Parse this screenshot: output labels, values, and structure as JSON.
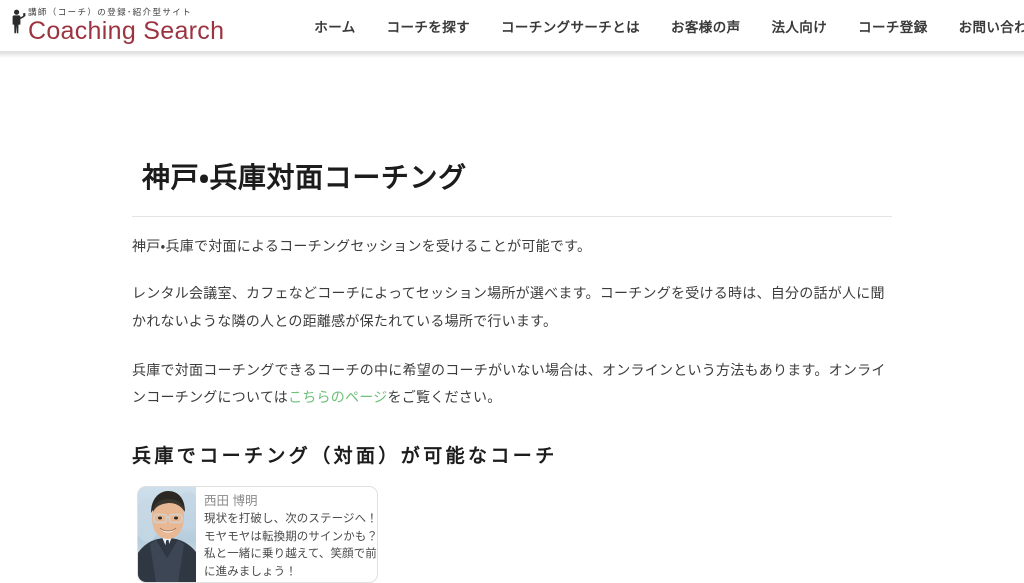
{
  "header": {
    "logo": {
      "tagline": "講師（コーチ）の登録･紹介型サイト",
      "name": "Coaching Search",
      "icon": "person-silhouette-icon",
      "brand_color": "#9b3440"
    },
    "nav_items": [
      {
        "label": "ホーム"
      },
      {
        "label": "コーチを探す"
      },
      {
        "label": "コーチングサーチとは"
      },
      {
        "label": "お客様の声"
      },
      {
        "label": "法人向け"
      },
      {
        "label": "コーチ登録"
      },
      {
        "label": "お問い合わせ"
      }
    ]
  },
  "main": {
    "page_title": "神戸・兵庫対面コーチング",
    "paragraph_1": "神戸・兵庫で対面によるコーチングセッションを受けることが可能です。",
    "paragraph_2": "レンタル会議室、カフェなどコーチによってセッション場所が選べます。コーチングを受ける時は、自分の話が人に聞かれないような隣の人との距離感が保たれている場所で行います。",
    "paragraph_3_before_link": "兵庫で対面コーチングできるコーチの中に希望のコーチがいない場合は、オンラインという方法もあります。オンラインコーチングについては",
    "paragraph_3_link": "こちらのページ",
    "paragraph_3_after_link": "をご覧ください。",
    "link_color": "#6fc07a",
    "section_title": "兵庫でコーチング（対面）が可能なコーチ",
    "coaches": [
      {
        "name": "西田 博明",
        "description_lines": [
          "現状を打破し、次のステージへ！",
          "モヤモヤは転換期のサインかも？",
          "私と一緒に乗り越えて、笑顔で前",
          "に進みましょう！"
        ],
        "photo": "coach-portrait-photo"
      }
    ]
  }
}
